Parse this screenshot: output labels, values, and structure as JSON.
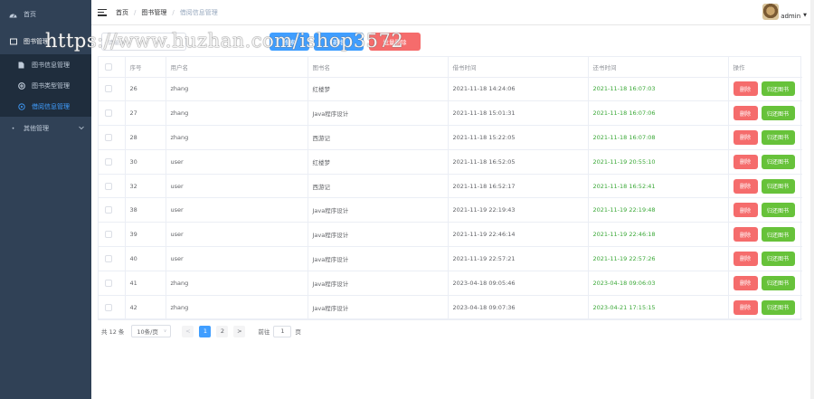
{
  "sidebar": {
    "home": "首页",
    "book_mgmt": "图书管理",
    "sub_items": [
      "图书信息管理",
      "图书类型管理",
      "借阅信息管理"
    ],
    "other": "其他管理"
  },
  "header": {
    "breadcrumb": [
      "首页",
      "图书管理",
      "借阅信息管理"
    ],
    "username": "admin"
  },
  "toolbar": {
    "search_placeholder": "请输入",
    "search_label": "搜索",
    "add_label": "新增",
    "delete_label": "批量删除"
  },
  "watermark": "https://www.huzhan.com/ishop3572",
  "table": {
    "columns": [
      "",
      "序号",
      "用户名",
      "图书名",
      "借书时间",
      "还书时间",
      "操作"
    ],
    "rows": [
      [
        "26",
        "zhang",
        "红楼梦",
        "2021-11-18 14:24:06",
        "2021-11-18 16:07:03"
      ],
      [
        "27",
        "zhang",
        "Java程序设计",
        "2021-11-18 15:01:31",
        "2021-11-18 16:07:06"
      ],
      [
        "28",
        "zhang",
        "西游记",
        "2021-11-18 15:22:05",
        "2021-11-18 16:07:08"
      ],
      [
        "30",
        "user",
        "红楼梦",
        "2021-11-18 16:52:05",
        "2021-11-19 20:55:10"
      ],
      [
        "32",
        "user",
        "西游记",
        "2021-11-18 16:52:17",
        "2021-11-18 16:52:41"
      ],
      [
        "38",
        "user",
        "Java程序设计",
        "2021-11-19 22:19:43",
        "2021-11-19 22:19:48"
      ],
      [
        "39",
        "user",
        "Java程序设计",
        "2021-11-19 22:46:14",
        "2021-11-19 22:46:18"
      ],
      [
        "40",
        "user",
        "Java程序设计",
        "2021-11-19 22:57:21",
        "2021-11-19 22:57:26"
      ],
      [
        "41",
        "zhang",
        "Java程序设计",
        "2023-04-18 09:05:46",
        "2023-04-18 09:06:03"
      ],
      [
        "42",
        "zhang",
        "Java程序设计",
        "2023-04-18 09:07:36",
        "2023-04-21 17:15:15"
      ]
    ],
    "delete_label": "删除",
    "return_label": "归还图书"
  },
  "pager": {
    "total": "共 12 条",
    "page_size": "10条/页",
    "pages": [
      "1",
      "2"
    ],
    "prev": "<",
    "next": ">",
    "goto_prefix": "前往",
    "goto_value": "1",
    "goto_suffix": "页"
  },
  "colors": {
    "sidebar_bg": "#304156",
    "submenu_bg": "#1f2d3d",
    "primary": "#409eff",
    "danger": "#f56c6c",
    "success": "#67c23a",
    "return_time": "#3aa837"
  }
}
